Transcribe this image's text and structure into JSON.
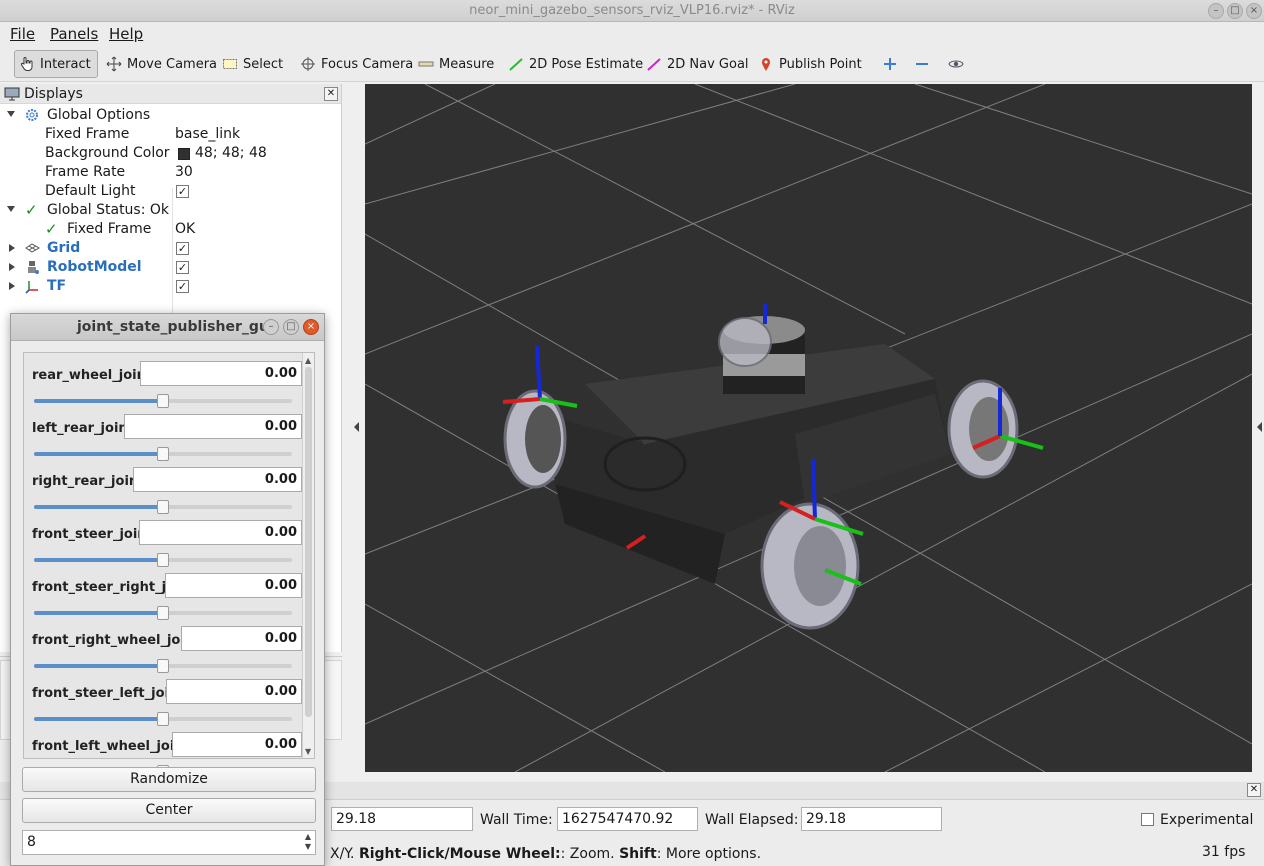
{
  "window": {
    "title": "neor_mini_gazebo_sensors_rviz_VLP16.rviz* - RViz"
  },
  "menu": [
    "File",
    "Panels",
    "Help"
  ],
  "toolbar": {
    "interact": "Interact",
    "move_camera": "Move Camera",
    "select": "Select",
    "focus_camera": "Focus Camera",
    "measure": "Measure",
    "pose_estimate": "2D Pose Estimate",
    "nav_goal": "2D Nav Goal",
    "publish_point": "Publish Point"
  },
  "displays": {
    "title": "Displays",
    "global_options": "Global Options",
    "fixed_frame_label": "Fixed Frame",
    "fixed_frame_value": "base_link",
    "bg_color_label": "Background Color",
    "bg_color_value": "48; 48; 48",
    "frame_rate_label": "Frame Rate",
    "frame_rate_value": "30",
    "default_light_label": "Default Light",
    "global_status": "Global Status: Ok",
    "status_fixed_frame": "Fixed Frame",
    "status_fixed_frame_value": "OK",
    "grid": "Grid",
    "robot_model": "RobotModel",
    "tf": "TF"
  },
  "jsp": {
    "title": "joint_state_publisher_gui",
    "joints": [
      {
        "name": "rear_wheel_joint",
        "value": "0.00"
      },
      {
        "name": "left_rear_joint",
        "value": "0.00"
      },
      {
        "name": "right_rear_joint",
        "value": "0.00"
      },
      {
        "name": "front_steer_joint",
        "value": "0.00"
      },
      {
        "name": "front_steer_right_joint",
        "value": "0.00"
      },
      {
        "name": "front_right_wheel_joint",
        "value": "0.00"
      },
      {
        "name": "front_steer_left_joint",
        "value": "0.00"
      },
      {
        "name": "front_left_wheel_joint",
        "value": "0.00"
      }
    ],
    "randomize": "Randomize",
    "center": "Center",
    "spin_value": "8"
  },
  "time": {
    "ros_elapsed": "29.18",
    "wall_time_label": "Wall Time:",
    "wall_time_value": "1627547470.92",
    "wall_elapsed_label": "Wall Elapsed:",
    "wall_elapsed_value": "29.18",
    "experimental": "Experimental"
  },
  "status": {
    "text_pre": "X/Y. ",
    "b1": "Right-Click/Mouse Wheel:",
    "t1": ": Zoom. ",
    "b2": "Shift",
    "t2": ": More options.",
    "fps": "31 fps"
  },
  "colors": {
    "background": "#303030",
    "accent": "#2a6ebd",
    "slider": "#5b8fc7"
  }
}
